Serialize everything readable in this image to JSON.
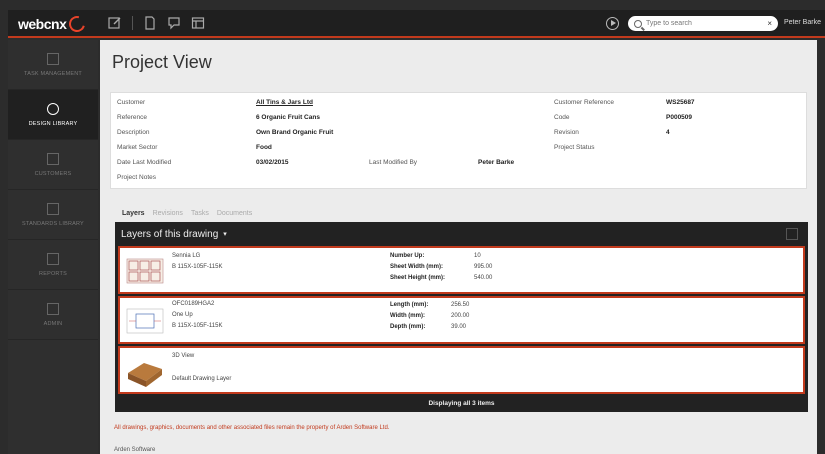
{
  "topbar": {
    "logo": "webcnx",
    "search_placeholder": "Type to search",
    "search_close": "×",
    "user": "Peter Barke"
  },
  "sidebar": {
    "items": [
      {
        "label": "TASK MANAGEMENT",
        "icon": "task-icon",
        "active": false
      },
      {
        "label": "DESIGN LIBRARY",
        "icon": "design-library-icon",
        "active": true
      },
      {
        "label": "CUSTOMERS",
        "icon": "customers-icon",
        "active": false
      },
      {
        "label": "STANDARDS LIBRARY",
        "icon": "standards-icon",
        "active": false
      },
      {
        "label": "REPORTS",
        "icon": "reports-icon",
        "active": false
      },
      {
        "label": "ADMIN",
        "icon": "admin-icon",
        "active": false
      }
    ]
  },
  "page": {
    "title": "Project View"
  },
  "info": {
    "customer_label": "Customer",
    "customer_value": "All Tins & Jars Ltd",
    "reference_label": "Reference",
    "reference_value": "6 Organic Fruit Cans",
    "description_label": "Description",
    "description_value": "Own Brand Organic Fruit",
    "market_label": "Market Sector",
    "market_value": "Food",
    "modified_label": "Date Last Modified",
    "modified_value": "03/02/2015",
    "modified_by_label": "Last Modified By",
    "modified_by_value": "Peter Barke",
    "notes_label": "Project Notes",
    "cust_ref_label": "Customer Reference",
    "cust_ref_value": "WS25687",
    "code_label": "Code",
    "code_value": "P000509",
    "revision_label": "Revision",
    "revision_value": "4",
    "status_label": "Project Status"
  },
  "tabs": [
    "Layers",
    "Revisions",
    "Tasks",
    "Documents"
  ],
  "layers": {
    "title": "Layers of this drawing",
    "caret": "▾",
    "footer": "Displaying all 3 items",
    "rows": [
      {
        "line1": "Sennia LG",
        "line2": "B 115X-105F-115K",
        "k1": "Number Up:",
        "v1": "10",
        "k2": "Sheet Width (mm):",
        "v2": "995.00",
        "k3": "Sheet Height (mm):",
        "v3": "540.00"
      },
      {
        "line1": "OFC0189HGA2",
        "line2": "One Up",
        "line3": "B 115X-105F-115K",
        "k1": "Length (mm):",
        "v1": "256.50",
        "k2": "Width (mm):",
        "v2": "200.00",
        "k3": "Depth (mm):",
        "v3": "39.00"
      },
      {
        "line1": "3D View",
        "line2": "Default Drawing Layer"
      }
    ]
  },
  "footer": {
    "disclaimer": "All drawings, graphics, documents and other associated files remain the property of Arden Software Ltd.",
    "company": "Arden Software"
  }
}
